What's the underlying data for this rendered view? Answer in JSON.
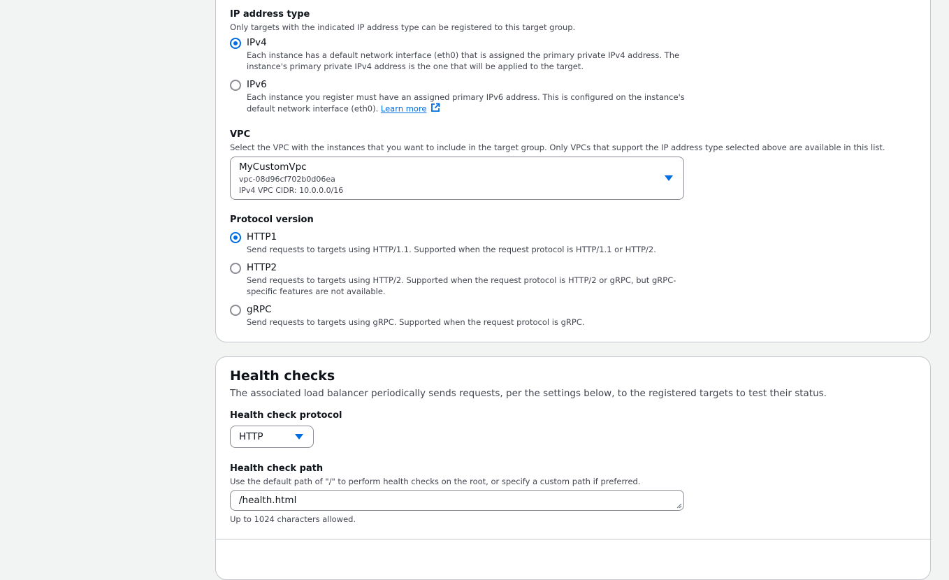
{
  "ip_address_type": {
    "label": "IP address type",
    "description": "Only targets with the indicated IP address type can be registered to this target group.",
    "options": [
      {
        "label": "IPv4",
        "selected": true,
        "desc_line1": "Each instance has a default network interface (eth0) that is assigned the primary private IPv4 address. The",
        "desc_line2": "instance's primary private IPv4 address is the one that will be applied to the target."
      },
      {
        "label": "IPv6",
        "selected": false,
        "desc_line1": "Each instance you register must have an assigned primary IPv6 address. This is configured on the instance's",
        "desc_line2": "default network interface (eth0).",
        "link_text": "Learn more"
      }
    ]
  },
  "vpc": {
    "label": "VPC",
    "description": "Select the VPC with the instances that you want to include in the target group. Only VPCs that support the IP address type selected above are available in this list.",
    "selected_name": "MyCustomVpc",
    "selected_id": "vpc-08d96cf702b0d06ea",
    "selected_cidr": "IPv4 VPC CIDR: 10.0.0.0/16"
  },
  "protocol_version": {
    "label": "Protocol version",
    "options": [
      {
        "label": "HTTP1",
        "selected": true,
        "desc_line1": "Send requests to targets using HTTP/1.1. Supported when the request protocol is HTTP/1.1 or HTTP/2."
      },
      {
        "label": "HTTP2",
        "selected": false,
        "desc_line1": "Send requests to targets using HTTP/2. Supported when the request protocol is HTTP/2 or gRPC, but gRPC-",
        "desc_line2": "specific features are not available."
      },
      {
        "label": "gRPC",
        "selected": false,
        "desc_line1": "Send requests to targets using gRPC. Supported when the request protocol is gRPC."
      }
    ]
  },
  "health_checks": {
    "title": "Health checks",
    "description": "The associated load balancer periodically sends requests, per the settings below, to the registered targets to test their status.",
    "protocol": {
      "label": "Health check protocol",
      "value": "HTTP"
    },
    "path": {
      "label": "Health check path",
      "description": "Use the default path of \"/\" to perform health checks on the root, or specify a custom path if preferred.",
      "value": "/health.html",
      "constraint": "Up to 1024 characters allowed."
    }
  },
  "colors": {
    "accent": "#006ce0",
    "page_bg": "#f2f3f3",
    "panel_bg": "#ffffff",
    "border": "#c6c6cd"
  },
  "icons": {
    "external_link": "external-link-icon",
    "dropdown": "caret-down-icon"
  }
}
